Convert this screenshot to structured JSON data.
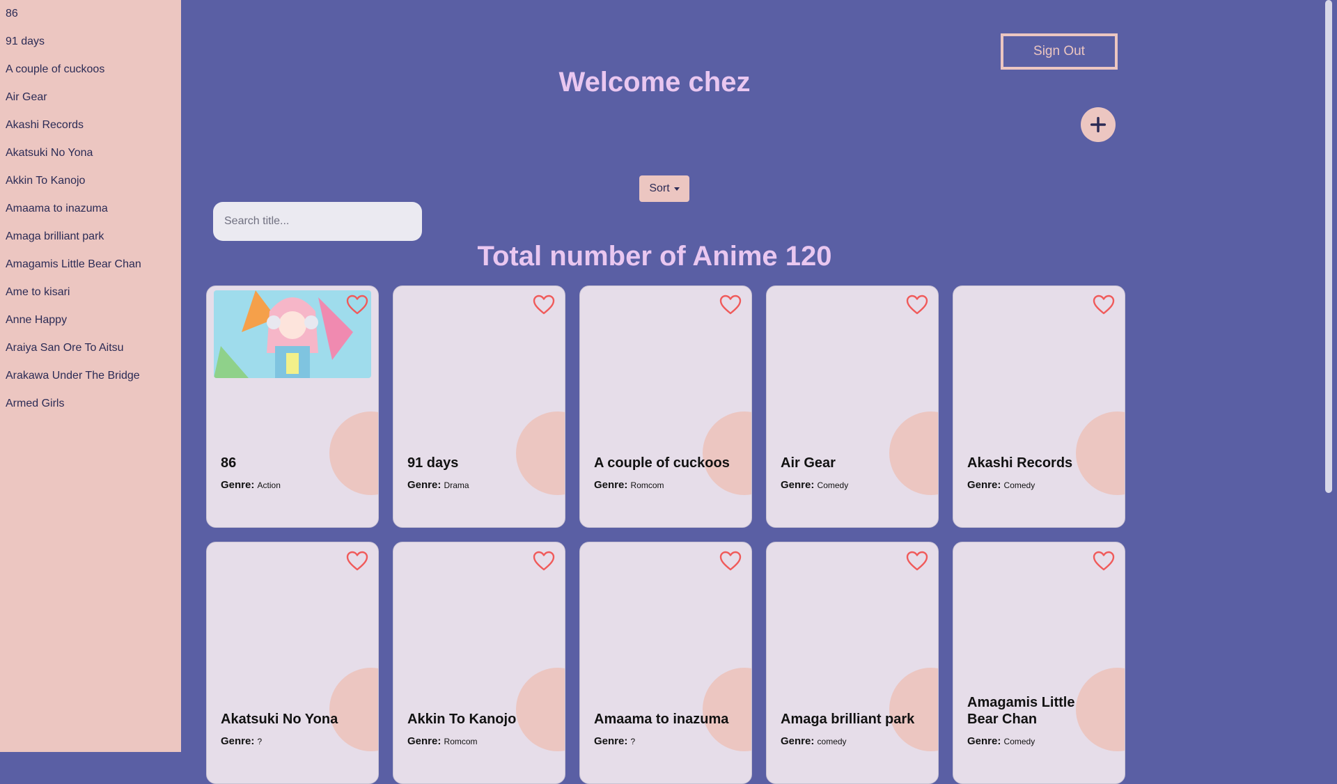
{
  "sidebar": {
    "items": [
      "86",
      "91 days",
      "A couple of cuckoos",
      "Air Gear",
      "Akashi Records",
      "Akatsuki No Yona",
      "Akkin To Kanojo",
      "Amaama to inazuma",
      "Amaga brilliant park",
      "Amagamis Little Bear Chan",
      "Ame to kisari",
      "Anne Happy",
      "Araiya San Ore To Aitsu",
      "Arakawa Under The Bridge",
      "Armed Girls"
    ]
  },
  "header": {
    "signout_label": "Sign Out",
    "welcome": "Welcome chez"
  },
  "controls": {
    "sort_label": "Sort",
    "search_placeholder": "Search title..."
  },
  "total_label": "Total number of Anime 120",
  "genre_label": "Genre:",
  "cards": [
    {
      "title": "86",
      "genre": "Action",
      "has_image": true
    },
    {
      "title": "91 days",
      "genre": "Drama"
    },
    {
      "title": "A couple of cuckoos",
      "genre": "Romcom"
    },
    {
      "title": "Air Gear",
      "genre": "Comedy"
    },
    {
      "title": "Akashi Records",
      "genre": "Comedy"
    },
    {
      "title": "Akatsuki No Yona",
      "genre": "?"
    },
    {
      "title": "Akkin To Kanojo",
      "genre": "Romcom"
    },
    {
      "title": "Amaama to inazuma",
      "genre": "?"
    },
    {
      "title": "Amaga brilliant park",
      "genre": "comedy"
    },
    {
      "title": "Amagamis Little Bear Chan",
      "genre": "Comedy"
    }
  ],
  "colors": {
    "background": "#5a5fa4",
    "sidebar": "#ecc6c1",
    "card": "#e6dde9",
    "heart": "#f05a5a",
    "heading": "#e9c7f0"
  }
}
